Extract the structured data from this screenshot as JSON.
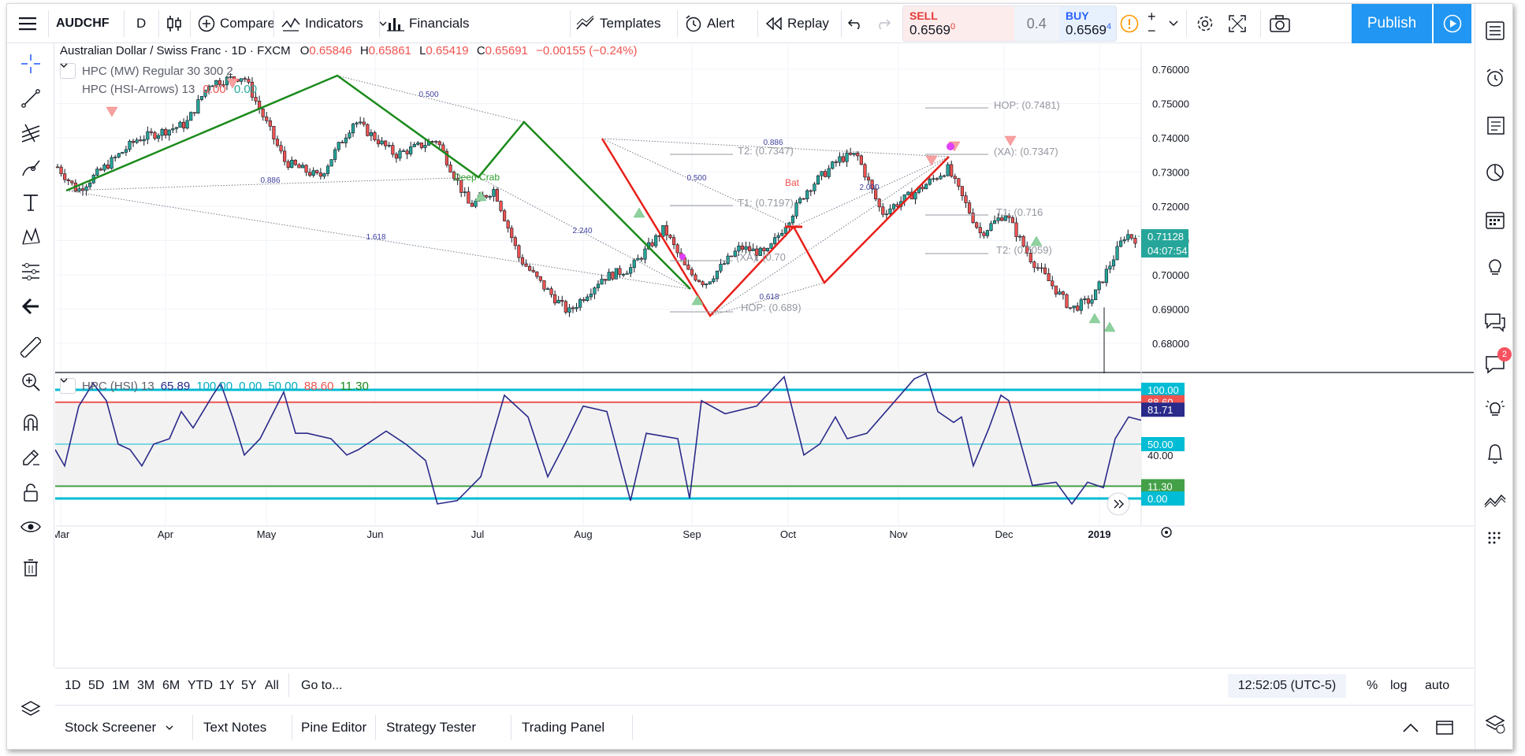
{
  "toolbar": {
    "symbol": "AUDCHF",
    "interval": "D",
    "compare": "Compare",
    "indicators": "Indicators",
    "financials": "Financials",
    "templates": "Templates",
    "alert": "Alert",
    "replay": "Replay",
    "sell_label": "SELL",
    "sell_price": "0.6569",
    "sell_price_sup": "0",
    "spread": "0.4",
    "buy_label": "BUY",
    "buy_price": "0.6569",
    "buy_price_sup": "4",
    "publish": "Publish"
  },
  "legend": {
    "title": "Australian Dollar / Swiss Franc · 1D · FXCM",
    "o_label": "O",
    "o": "0.65846",
    "h_label": "H",
    "h": "0.65861",
    "l_label": "L",
    "l": "0.65419",
    "c_label": "C",
    "c": "0.65691",
    "change": "−0.00155 (−0.24%)",
    "ind1": "HPC (MW) Regular 30 300 2",
    "ind2_name": "HPC (HSI-Arrows) 13",
    "ind2_v1": "0.00",
    "ind2_v2": "0.00",
    "osc_name": "HPC (HSI) 13",
    "osc_v1": "65.89",
    "osc_v2": "100.00",
    "osc_v3": "0.00",
    "osc_v4": "50.00",
    "osc_v5": "88.60",
    "osc_v6": "11.30"
  },
  "price_axis": [
    "0.76000",
    "0.75000",
    "0.74000",
    "0.73000",
    "0.72000",
    "0.71000",
    "0.70000",
    "0.69000",
    "0.68000"
  ],
  "price_badges": {
    "last": "0.71128",
    "countdown": "04:07:54"
  },
  "osc_axis": {
    "b100": "100.00",
    "b886": "88.60",
    "b8171": "81.71",
    "b50": "50.00",
    "t40": "40.00",
    "b113": "11.30",
    "b0": "0.00"
  },
  "time_axis": [
    "Mar",
    "Apr",
    "May",
    "Jun",
    "Jul",
    "Aug",
    "Sep",
    "Oct",
    "Nov",
    "Dec",
    "2019"
  ],
  "annotations": {
    "r0500a": "0.500",
    "r0886a": "0.886",
    "r1618": "1.618",
    "r2240": "2.240",
    "r0886b": "0.886",
    "r0500b": "0.500",
    "r2000": "2.000",
    "r0618": "0.618",
    "deep_crab": "Deep Crab",
    "bat": "Bat",
    "t2a": "T2: (0.7347)",
    "t1a": "T1: (0.7197)",
    "xaa": "(XA): (0.70",
    "hopa": "HOP: (0.689)",
    "hopb": "HOP: (0.7481)",
    "xab": "(XA): (0.7347)",
    "t1b": "T1: (0.716",
    "t2b": "T2: (0.7059)"
  },
  "timeframes": [
    "1D",
    "5D",
    "1M",
    "3M",
    "6M",
    "YTD",
    "1Y",
    "5Y",
    "All"
  ],
  "goto": "Go to...",
  "clock": "12:52:05 (UTC-5)",
  "scale_opts": {
    "percent": "%",
    "log": "log",
    "auto": "auto"
  },
  "panels": [
    "Stock Screener",
    "Text Notes",
    "Pine Editor",
    "Strategy Tester",
    "Trading Panel"
  ],
  "notification_count": "2",
  "colors": {
    "up": "#26a69a",
    "down": "#ef5350",
    "green_pattern": "#1b8a1b",
    "red_pattern": "#e8201a",
    "osc_line": "#2a2a8a",
    "cyan": "#00bcd4",
    "publish": "#2196f3",
    "badge_navy": "#2a2a8a"
  },
  "icons": [
    "hamburger-menu-icon",
    "candles-icon",
    "compare-plus-icon",
    "indicators-icon",
    "financials-icon",
    "templates-icon",
    "alert-clock-icon",
    "replay-icon",
    "undo-icon",
    "redo-icon",
    "info-icon",
    "gear-icon",
    "fullscreen-icon",
    "camera-icon",
    "play-icon"
  ]
}
